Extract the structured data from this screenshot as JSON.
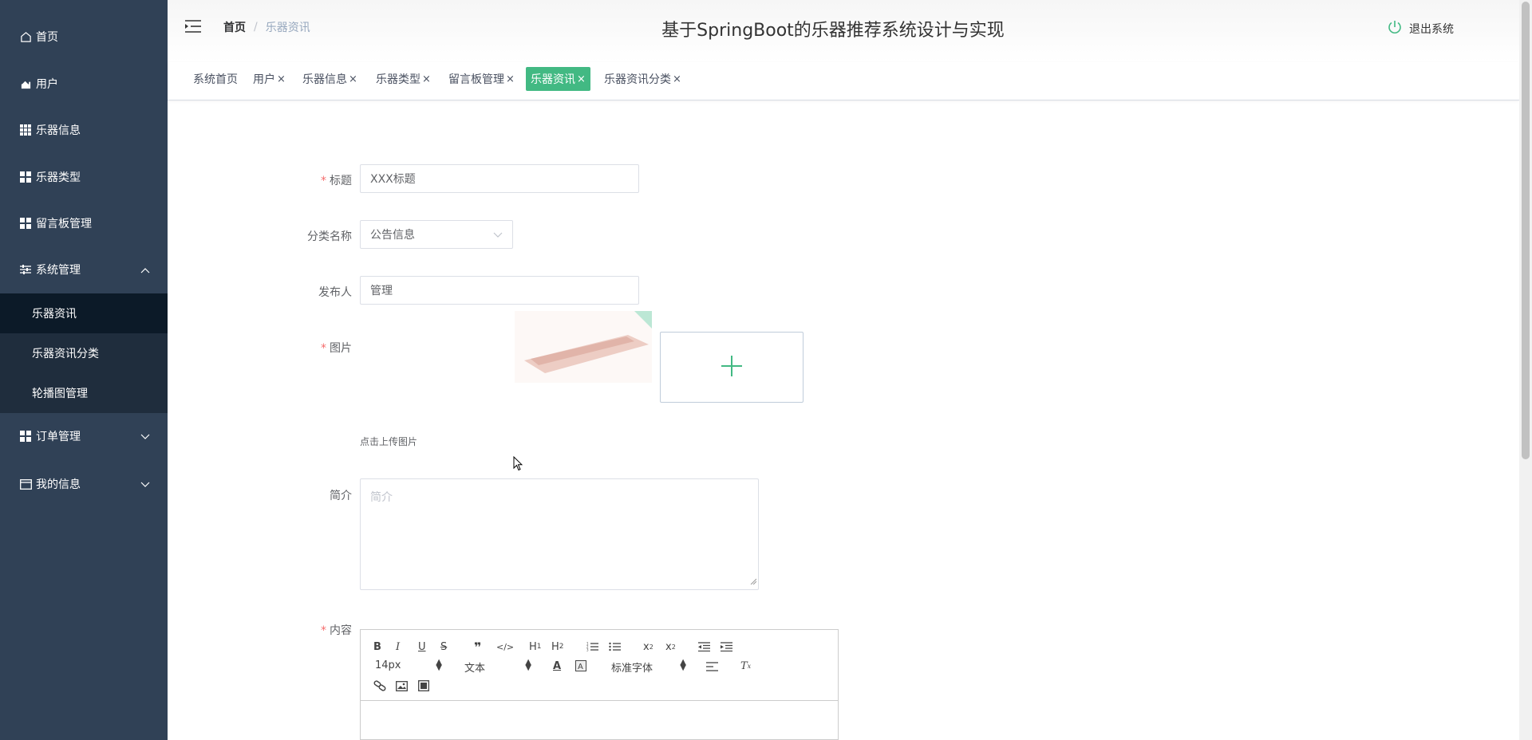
{
  "sidebar": {
    "items": [
      {
        "label": "首页",
        "icon": "home-icon"
      },
      {
        "label": "用户",
        "icon": "user-icon"
      },
      {
        "label": "乐器信息",
        "icon": "grid-icon"
      },
      {
        "label": "乐器类型",
        "icon": "apps-icon"
      },
      {
        "label": "留言板管理",
        "icon": "apps-icon"
      },
      {
        "label": "系统管理",
        "icon": "sliders-icon",
        "expanded": true
      },
      {
        "label": "订单管理",
        "icon": "apps-icon",
        "expanded": false
      },
      {
        "label": "我的信息",
        "icon": "card-icon",
        "expanded": false
      }
    ],
    "system_submenu": [
      {
        "label": "乐器资讯",
        "active": true
      },
      {
        "label": "乐器资讯分类",
        "active": false
      },
      {
        "label": "轮播图管理",
        "active": false
      }
    ]
  },
  "header": {
    "breadcrumb_home": "首页",
    "breadcrumb_sep": "/",
    "breadcrumb_current": "乐器资讯",
    "title": "基于SpringBoot的乐器推荐系统设计与实现",
    "logout_label": "退出系统"
  },
  "tabs": [
    {
      "label": "系统首页",
      "closable": false,
      "active": false
    },
    {
      "label": "用户",
      "closable": true,
      "active": false
    },
    {
      "label": "乐器信息",
      "closable": true,
      "active": false
    },
    {
      "label": "乐器类型",
      "closable": true,
      "active": false
    },
    {
      "label": "留言板管理",
      "closable": true,
      "active": false
    },
    {
      "label": "乐器资讯",
      "closable": true,
      "active": true
    },
    {
      "label": "乐器资讯分类",
      "closable": true,
      "active": false
    }
  ],
  "tab_close_glyph": "×",
  "form": {
    "title_label": "标题",
    "title_value": "XXX标题",
    "category_label": "分类名称",
    "category_value": "公告信息",
    "publisher_label": "发布人",
    "publisher_value": "管理",
    "image_label": "图片",
    "upload_tip": "点击上传图片",
    "intro_label": "简介",
    "intro_placeholder": "简介",
    "content_label": "内容",
    "required_mark": "*"
  },
  "editor": {
    "font_size": "14px",
    "header_select": "文本",
    "font_family": "标准字体"
  },
  "colors": {
    "sidebar_bg": "#304156",
    "accent": "#42b983",
    "required": "#f56c6c"
  }
}
